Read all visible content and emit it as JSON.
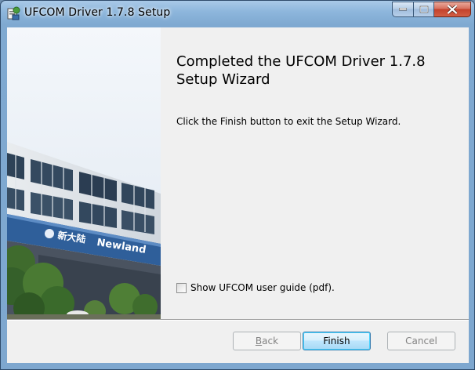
{
  "window": {
    "title": "UFCOM Driver 1.7.8 Setup",
    "icons": {
      "app": "installer-icon",
      "minimize": "minimize-icon",
      "maximize": "maximize-icon",
      "close": "close-icon"
    }
  },
  "banner": {
    "sign_chinese": "新大陆",
    "sign_english": "Newland"
  },
  "content": {
    "heading": "Completed the UFCOM Driver 1.7.8 Setup Wizard",
    "description": "Click the Finish button to exit the Setup Wizard.",
    "checkbox_label": "Show UFCOM user guide (pdf).",
    "checkbox_checked": false
  },
  "buttons": {
    "back": {
      "label_underlined": "B",
      "label_rest": "ack",
      "enabled": false
    },
    "finish": {
      "label": "Finish",
      "enabled": true
    },
    "cancel": {
      "label": "Cancel",
      "enabled": false
    }
  }
}
